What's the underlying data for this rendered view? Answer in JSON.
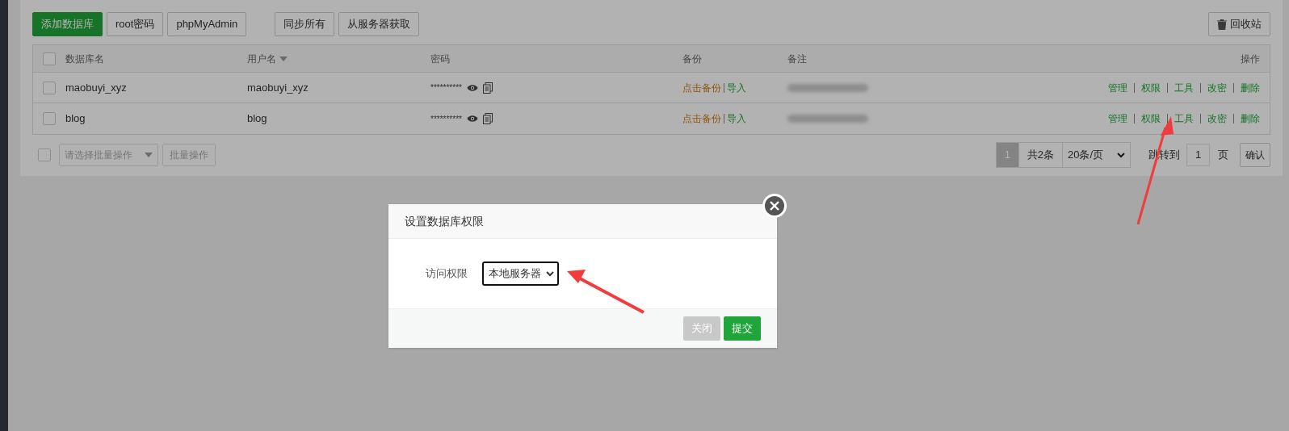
{
  "toolbar": {
    "left_buttons": [
      {
        "label": "添加数据库",
        "kind": "primary"
      },
      {
        "label": "root密码",
        "kind": "default"
      },
      {
        "label": "phpMyAdmin",
        "kind": "default"
      }
    ],
    "sync_buttons": [
      "同步所有",
      "从服务器获取"
    ],
    "recycle_button": "回收站"
  },
  "table": {
    "header_checked": false,
    "columns": [
      {
        "label": "数据库名",
        "sorted": false
      },
      {
        "label": "用户名",
        "sorted": true
      },
      {
        "label": "密码",
        "sorted": false
      },
      {
        "label": "备份",
        "sorted": false
      },
      {
        "label": "备注",
        "sorted": false
      },
      {
        "label": "操作",
        "sorted": false
      }
    ],
    "rows": [
      {
        "checked": false,
        "name": "maobuyi_xyz",
        "user": "maobuyi_xyz",
        "password": "**********",
        "backup_link": "点击备份",
        "import_link": "导入",
        "actions": [
          "管理",
          "权限",
          "工具",
          "改密",
          "删除"
        ]
      },
      {
        "checked": false,
        "name": "blog",
        "user": "blog",
        "password": "**********",
        "backup_link": "点击备份",
        "import_link": "导入",
        "actions": [
          "管理",
          "权限",
          "工具",
          "改密",
          "删除"
        ]
      }
    ]
  },
  "footer": {
    "select_all_checked": false,
    "batch_select": {
      "placeholder": "请选择批量操作"
    },
    "batch_button": "批量操作",
    "pagination": {
      "current_page": "1",
      "total": "共2条",
      "page_size": "20条/页",
      "jump_label": "跳转到",
      "jump_value": "1",
      "page_unit": "页",
      "confirm": "确认"
    }
  },
  "dialog": {
    "title": "设置数据库权限",
    "field_label": "访问权限",
    "select_value": "本地服务器",
    "buttons": [
      {
        "label": "关闭",
        "kind": "secondary"
      },
      {
        "label": "提交",
        "kind": "primary"
      }
    ]
  }
}
